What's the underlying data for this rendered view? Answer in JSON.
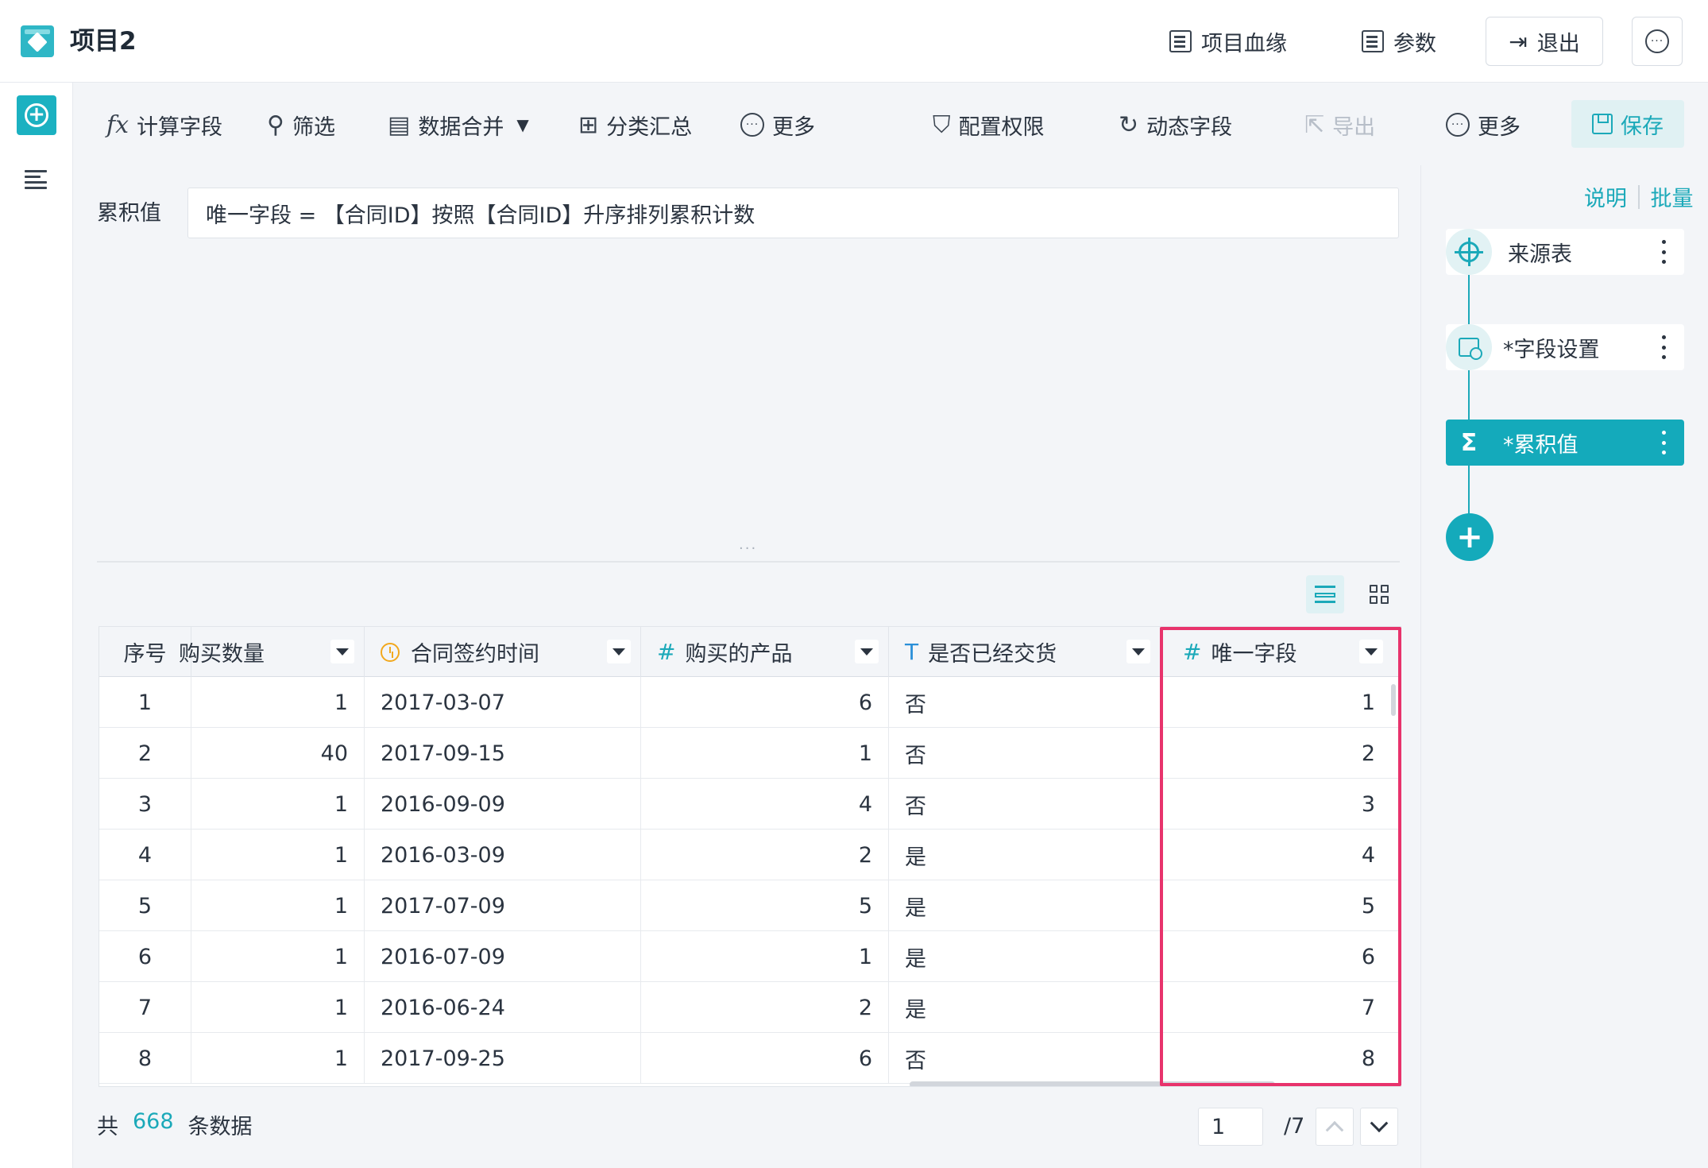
{
  "header": {
    "project_title": "项目2",
    "lineage_label": "项目血缘",
    "params_label": "参数",
    "exit_label": "退出",
    "more_icon": "ellipsis-circle-icon"
  },
  "toolbar": {
    "calc_field": "计算字段",
    "filter": "筛选",
    "merge": "数据合并",
    "group_summary": "分类汇总",
    "more_left": "更多",
    "permissions": "配置权限",
    "dynamic_field": "动态字段",
    "export": "导出",
    "more_right": "更多",
    "save": "保存",
    "fx_glyph": "fx"
  },
  "formula": {
    "label": "累积值",
    "text": "唯一字段 = 【合同ID】按照【合同ID】升序排列累积计数"
  },
  "table": {
    "columns": [
      {
        "label": "序号",
        "type": ""
      },
      {
        "label": "购买数量",
        "type": ""
      },
      {
        "label": "合同签约时间",
        "type": "date"
      },
      {
        "label": "购买的产品",
        "type": "#"
      },
      {
        "label": "是否已经交货",
        "type": "T"
      },
      {
        "label": "唯一字段",
        "type": "#"
      }
    ],
    "rows": [
      {
        "idx": "1",
        "qty": "1",
        "date": "2017-03-07",
        "product": "6",
        "delivered": "否",
        "unique": "1"
      },
      {
        "idx": "2",
        "qty": "40",
        "date": "2017-09-15",
        "product": "1",
        "delivered": "否",
        "unique": "2"
      },
      {
        "idx": "3",
        "qty": "1",
        "date": "2016-09-09",
        "product": "4",
        "delivered": "否",
        "unique": "3"
      },
      {
        "idx": "4",
        "qty": "1",
        "date": "2016-03-09",
        "product": "2",
        "delivered": "是",
        "unique": "4"
      },
      {
        "idx": "5",
        "qty": "1",
        "date": "2017-07-09",
        "product": "5",
        "delivered": "是",
        "unique": "5"
      },
      {
        "idx": "6",
        "qty": "1",
        "date": "2016-07-09",
        "product": "1",
        "delivered": "是",
        "unique": "6"
      },
      {
        "idx": "7",
        "qty": "1",
        "date": "2016-06-24",
        "product": "2",
        "delivered": "是",
        "unique": "7"
      },
      {
        "idx": "8",
        "qty": "1",
        "date": "2017-09-25",
        "product": "6",
        "delivered": "否",
        "unique": "8"
      }
    ]
  },
  "footer": {
    "total_prefix": "共",
    "total_count": "668",
    "total_suffix": "条数据",
    "page_current": "1",
    "page_total": "/7"
  },
  "steps_panel": {
    "help_link": "说明",
    "batch_link": "批量",
    "steps": [
      {
        "label": "来源表",
        "icon": "target-icon"
      },
      {
        "label": "*字段设置",
        "icon": "field-settings-icon"
      },
      {
        "label": "*累积值",
        "icon": "cumulative-sum-icon"
      }
    ]
  },
  "colors": {
    "accent": "#1bb1c1",
    "highlight": "#e8336c",
    "date_icon": "#f2a81d"
  }
}
